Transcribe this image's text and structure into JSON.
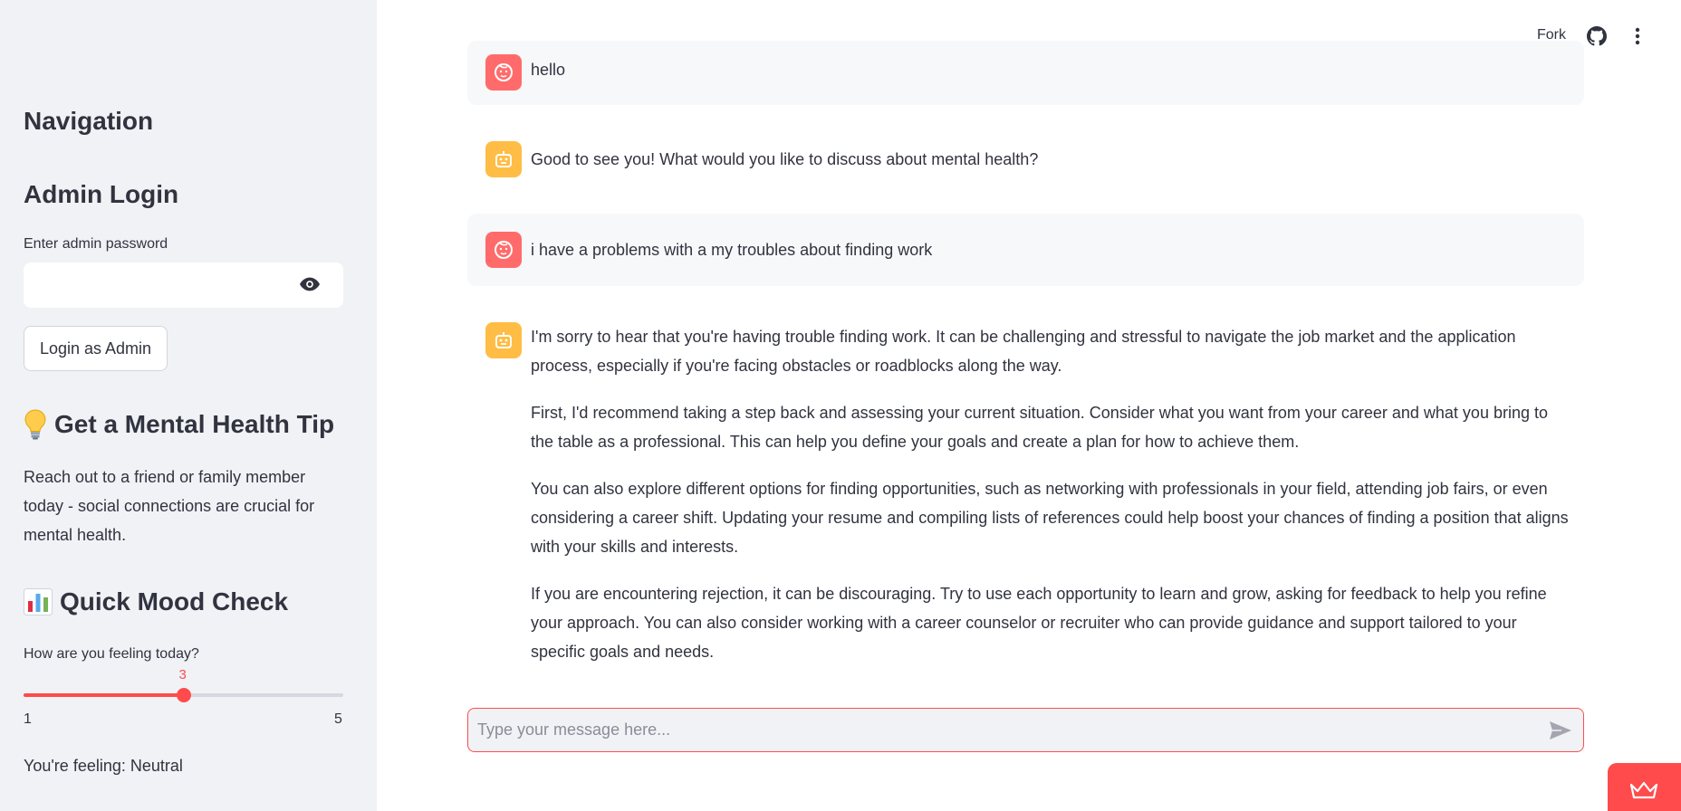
{
  "sidebar": {
    "nav_title": "Navigation",
    "admin_title": "Admin Login",
    "password_label": "Enter admin password",
    "password_value": "",
    "login_button": "Login as Admin",
    "tip_title": "Get a Mental Health Tip",
    "tip_icon": "lightbulb-icon",
    "tip_text": "Reach out to a friend or family member today - social connections are crucial for mental health.",
    "mood_title": "Quick Mood Check",
    "mood_icon": "bar-chart-icon",
    "mood_question": "How are you feeling today?",
    "slider": {
      "value": 3,
      "min": 1,
      "max": 5,
      "min_label": "1",
      "max_label": "5",
      "value_label": "3"
    },
    "feeling_text": "You're feeling: Neutral"
  },
  "header": {
    "fork_label": "Fork",
    "github_icon": "github-icon",
    "menu_icon": "more-vertical-icon"
  },
  "chat": {
    "messages": [
      {
        "role": "user",
        "paragraphs": [
          "hello"
        ]
      },
      {
        "role": "assistant",
        "paragraphs": [
          "Good to see you! What would you like to discuss about mental health?"
        ]
      },
      {
        "role": "user",
        "paragraphs": [
          "i have a problems with a my troubles about finding work"
        ]
      },
      {
        "role": "assistant",
        "paragraphs": [
          "I'm sorry to hear that you're having trouble finding work. It can be challenging and stressful to navigate the job market and the application process, especially if you're facing obstacles or roadblocks along the way.",
          "First, I'd recommend taking a step back and assessing your current situation. Consider what you want from your career and what you bring to the table as a professional. This can help you define your goals and create a plan for how to achieve them.",
          "You can also explore different options for finding opportunities, such as networking with professionals in your field, attending job fairs, or even considering a career shift. Updating your resume and compiling lists of references could help boost your chances of finding a position that aligns with your skills and interests.",
          "If you are encountering rejection, it can be discouraging. Try to use each opportunity to learn and grow, asking for feedback to help you refine your approach. You can also consider working with a career counselor or recruiter who can provide guidance and support tailored to your specific goals and needs."
        ]
      }
    ],
    "input_placeholder": "Type your message here...",
    "input_value": ""
  },
  "colors": {
    "accent": "#ff4b4b",
    "sidebar_bg": "#f0f2f6",
    "user_avatar": "#ff6b6b",
    "bot_avatar": "#ffbd45",
    "text": "#31333f"
  }
}
